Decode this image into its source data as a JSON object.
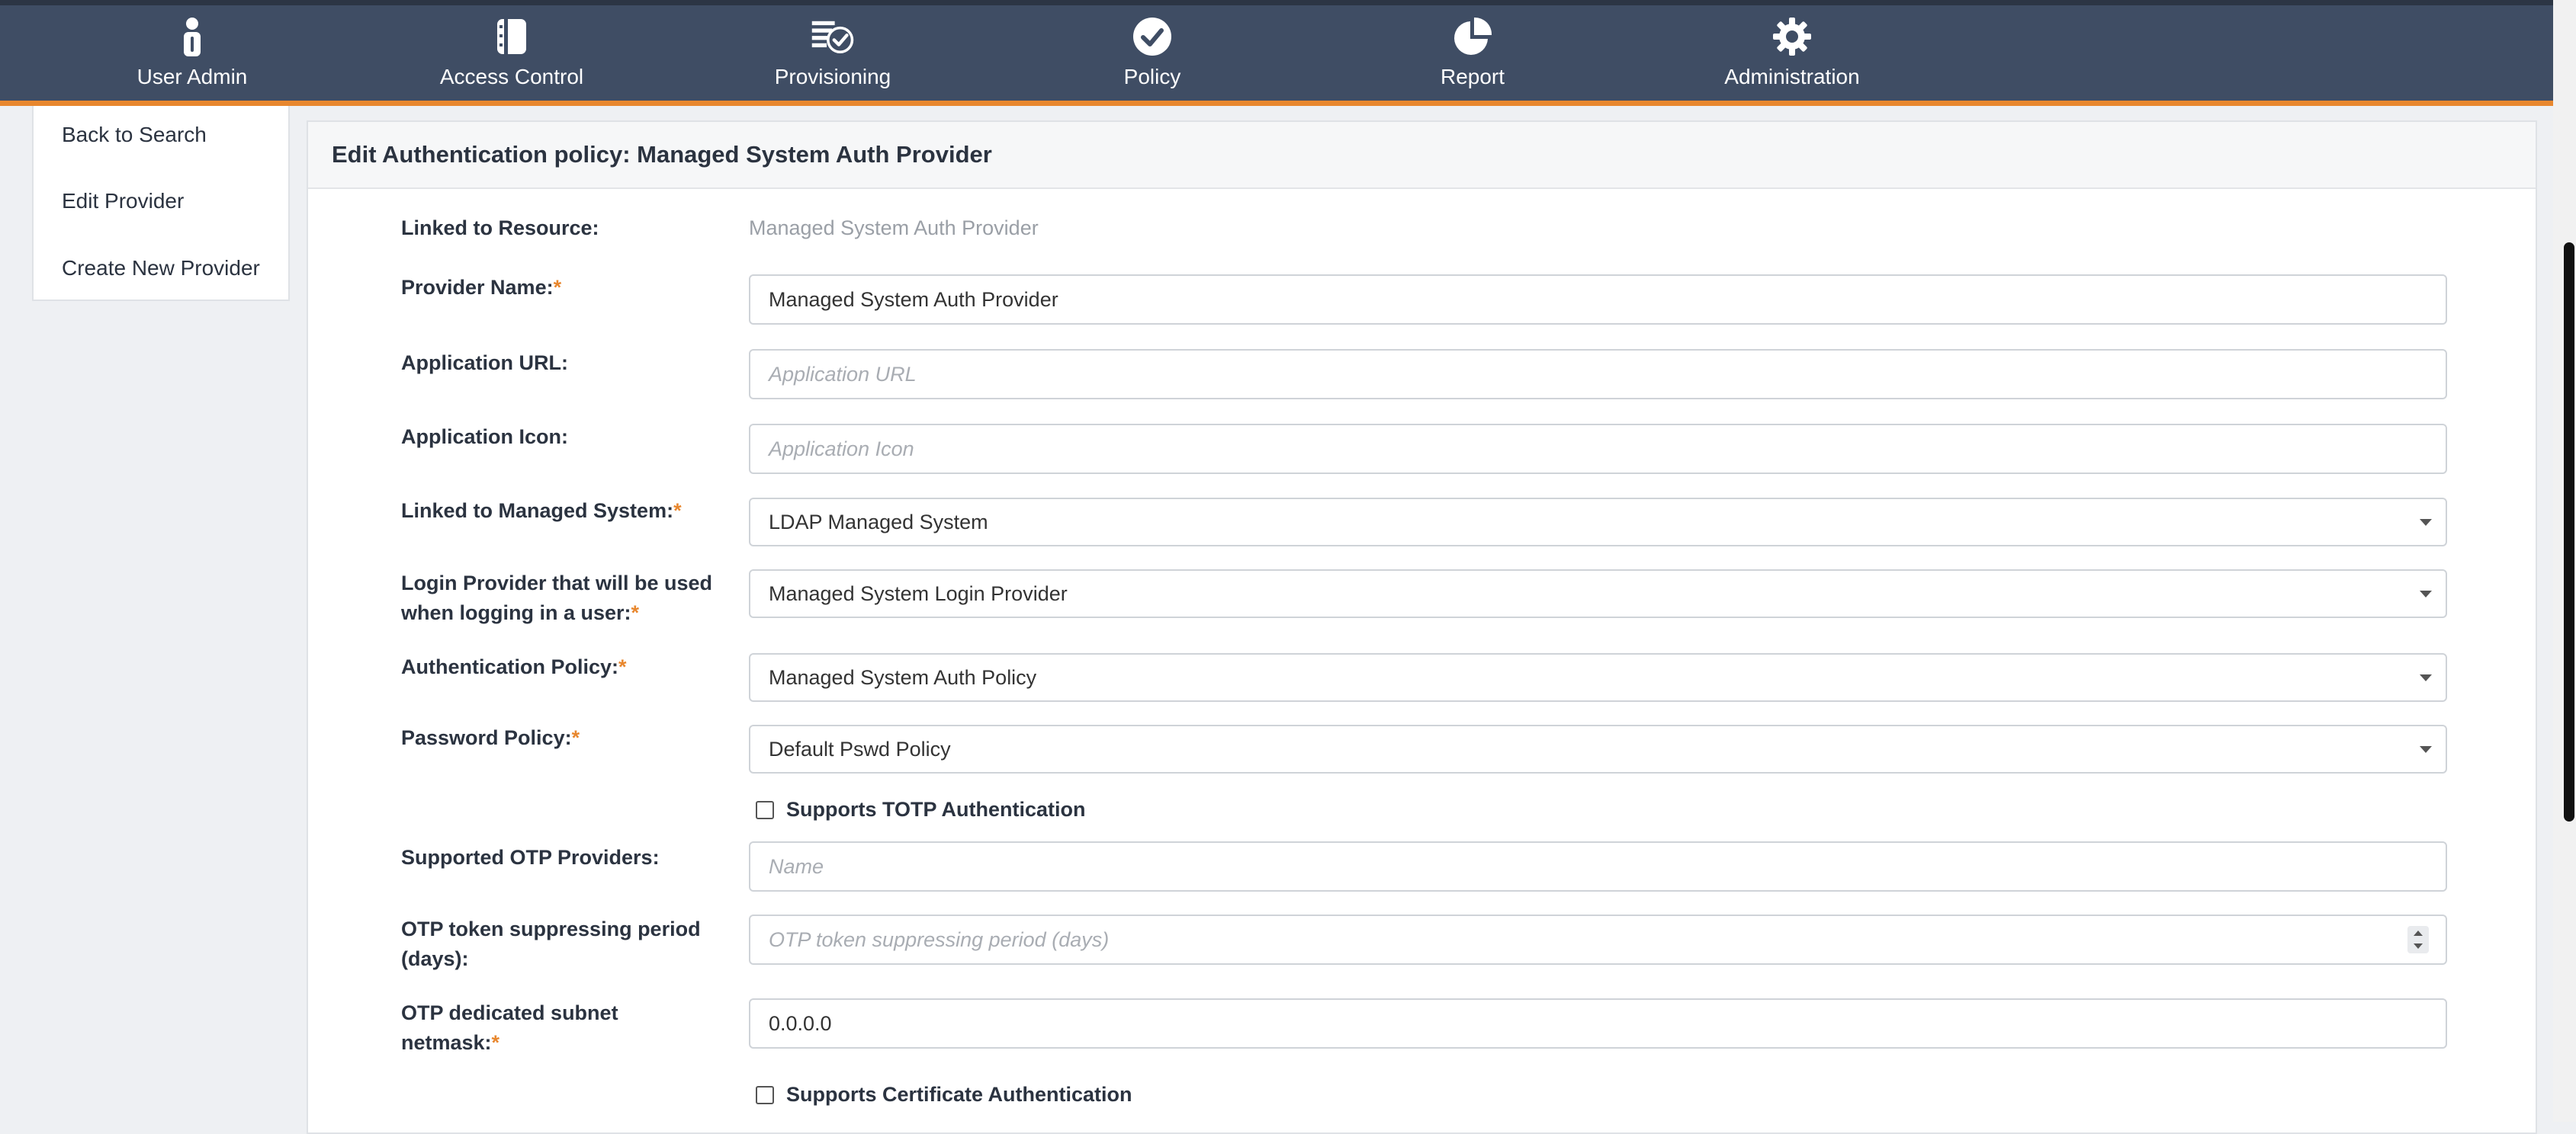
{
  "nav": [
    {
      "label": "User Admin",
      "icon": "user-icon"
    },
    {
      "label": "Access Control",
      "icon": "book-icon"
    },
    {
      "label": "Provisioning",
      "icon": "provisioning-icon"
    },
    {
      "label": "Policy",
      "icon": "check-circle-icon"
    },
    {
      "label": "Report",
      "icon": "pie-chart-icon"
    },
    {
      "label": "Administration",
      "icon": "gear-icon"
    }
  ],
  "sidebar": {
    "items": [
      {
        "label": "Back to Search"
      },
      {
        "label": "Edit Provider"
      },
      {
        "label": "Create New Provider"
      }
    ]
  },
  "form": {
    "title": "Edit Authentication policy: Managed System Auth Provider",
    "linked_resource": {
      "label": "Linked to Resource:",
      "value": "Managed System Auth Provider"
    },
    "provider_name": {
      "label": "Provider Name:",
      "required": "*",
      "value": "Managed System Auth Provider"
    },
    "application_url": {
      "label": "Application URL:",
      "placeholder": "Application URL"
    },
    "application_icon": {
      "label": "Application Icon:",
      "placeholder": "Application Icon"
    },
    "managed_system": {
      "label": "Linked to Managed System:",
      "required": "*",
      "value": "LDAP Managed System"
    },
    "login_provider": {
      "label_line1": "Login Provider that will be used",
      "label_line2": "when logging in a user:",
      "required": "*",
      "value": "Managed System Login Provider"
    },
    "auth_policy": {
      "label": "Authentication Policy:",
      "required": "*",
      "value": "Managed System Auth Policy"
    },
    "password_policy": {
      "label": "Password Policy:",
      "required": "*",
      "value": "Default Pswd Policy"
    },
    "totp": {
      "label": "Supports TOTP Authentication",
      "checked": false
    },
    "otp_providers": {
      "label": "Supported OTP Providers:",
      "placeholder": "Name"
    },
    "otp_period": {
      "label_line1": "OTP token suppressing period",
      "label_line2": "(days):",
      "placeholder": "OTP token suppressing period (days)"
    },
    "otp_subnet": {
      "label_line1": "OTP dedicated subnet",
      "label_line2": "netmask:",
      "required": "*",
      "value": "0.0.0.0"
    },
    "cert_auth": {
      "label": "Supports Certificate Authentication",
      "checked": false
    }
  },
  "colors": {
    "nav_bg": "#3f4d64",
    "accent": "#e8872e",
    "required": "#e8872e"
  }
}
